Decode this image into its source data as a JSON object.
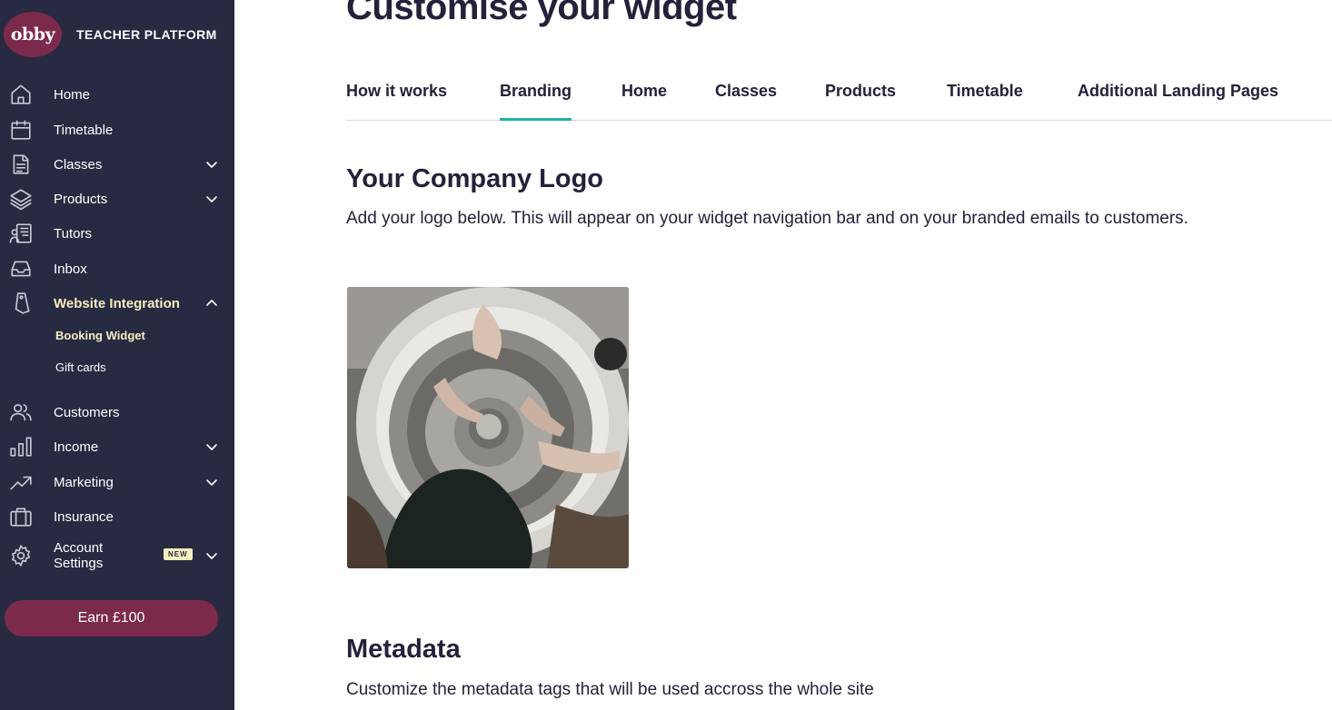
{
  "brand": {
    "logo_text": "obby",
    "platform_label": "TEACHER PLATFORM"
  },
  "sidebar": {
    "items": [
      {
        "label": "Home",
        "icon": "home-icon"
      },
      {
        "label": "Timetable",
        "icon": "calendar-icon"
      },
      {
        "label": "Classes",
        "icon": "document-icon",
        "expandable": true
      },
      {
        "label": "Products",
        "icon": "layers-icon",
        "expandable": true
      },
      {
        "label": "Tutors",
        "icon": "tutors-icon"
      },
      {
        "label": "Inbox",
        "icon": "inbox-icon"
      },
      {
        "label": "Website Integration",
        "icon": "tag-icon",
        "expanded": true,
        "active": true
      },
      {
        "label": "Customers",
        "icon": "users-icon"
      },
      {
        "label": "Income",
        "icon": "bar-chart-icon",
        "expandable": true
      },
      {
        "label": "Marketing",
        "icon": "trending-up-icon",
        "expandable": true
      },
      {
        "label": "Insurance",
        "icon": "briefcase-icon"
      },
      {
        "label": "Account Settings",
        "label_line1": "Account",
        "label_line2": "Settings",
        "icon": "gear-icon",
        "badge": "NEW",
        "expandable": true
      }
    ],
    "subitems": [
      {
        "label": "Booking Widget",
        "active": true
      },
      {
        "label": "Gift cards"
      }
    ],
    "earn_button": "Earn £100"
  },
  "colors": {
    "sidebar_bg": "#282a41",
    "brand_accent": "#7c2a4b",
    "active_text": "#f5efc0",
    "tab_underline": "#22b0a9",
    "text_dark": "#22223a"
  },
  "main": {
    "title": "Customise your widget",
    "tabs": [
      {
        "label": "How it works"
      },
      {
        "label": "Branding",
        "active": true
      },
      {
        "label": "Home"
      },
      {
        "label": "Classes"
      },
      {
        "label": "Products"
      },
      {
        "label": "Timetable"
      },
      {
        "label": "Additional Landing Pages"
      }
    ],
    "logo_section": {
      "title": "Your Company Logo",
      "description": "Add your logo below. This will appear on your widget navigation bar and on your branded emails to customers."
    },
    "metadata_section": {
      "title": "Metadata",
      "description": "Customize the metadata tags that will be used accross the whole site"
    }
  }
}
